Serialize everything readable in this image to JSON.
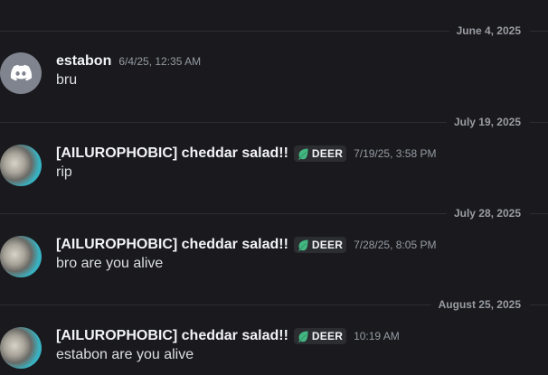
{
  "colors": {
    "background": "#1a1a1e",
    "divider": "#2c2d33",
    "date_text": "#9a9ca3",
    "username": "#f2f3f5",
    "message_text": "#dbdee1",
    "timestamp": "#959ba3",
    "tag_bg": "#2b2d31",
    "leaf_green": "#43b581",
    "discord_avatar_bg": "#80848e"
  },
  "dividers": [
    {
      "date": "June 4, 2025"
    },
    {
      "date": "July 19, 2025"
    },
    {
      "date": "July 28, 2025"
    },
    {
      "date": "August 25, 2025"
    }
  ],
  "messages": [
    {
      "avatar": "discord-default-avatar",
      "username": "estabon",
      "tag": "",
      "timestamp": "6/4/25, 12:35 AM",
      "content": "bru"
    },
    {
      "avatar": "cat-avatar",
      "username": "[AILUROPHOBIC] cheddar salad!!",
      "tag_icon": "leaf-icon",
      "tag": "DEER",
      "timestamp": "7/19/25, 3:58 PM",
      "content": "rip"
    },
    {
      "avatar": "cat-avatar",
      "username": "[AILUROPHOBIC] cheddar salad!!",
      "tag_icon": "leaf-icon",
      "tag": "DEER",
      "timestamp": "7/28/25, 8:05 PM",
      "content": "bro are you alive"
    },
    {
      "avatar": "cat-avatar",
      "username": "[AILUROPHOBIC] cheddar salad!!",
      "tag_icon": "leaf-icon",
      "tag": "DEER",
      "timestamp": "10:19 AM",
      "content": "estabon are you alive"
    }
  ]
}
